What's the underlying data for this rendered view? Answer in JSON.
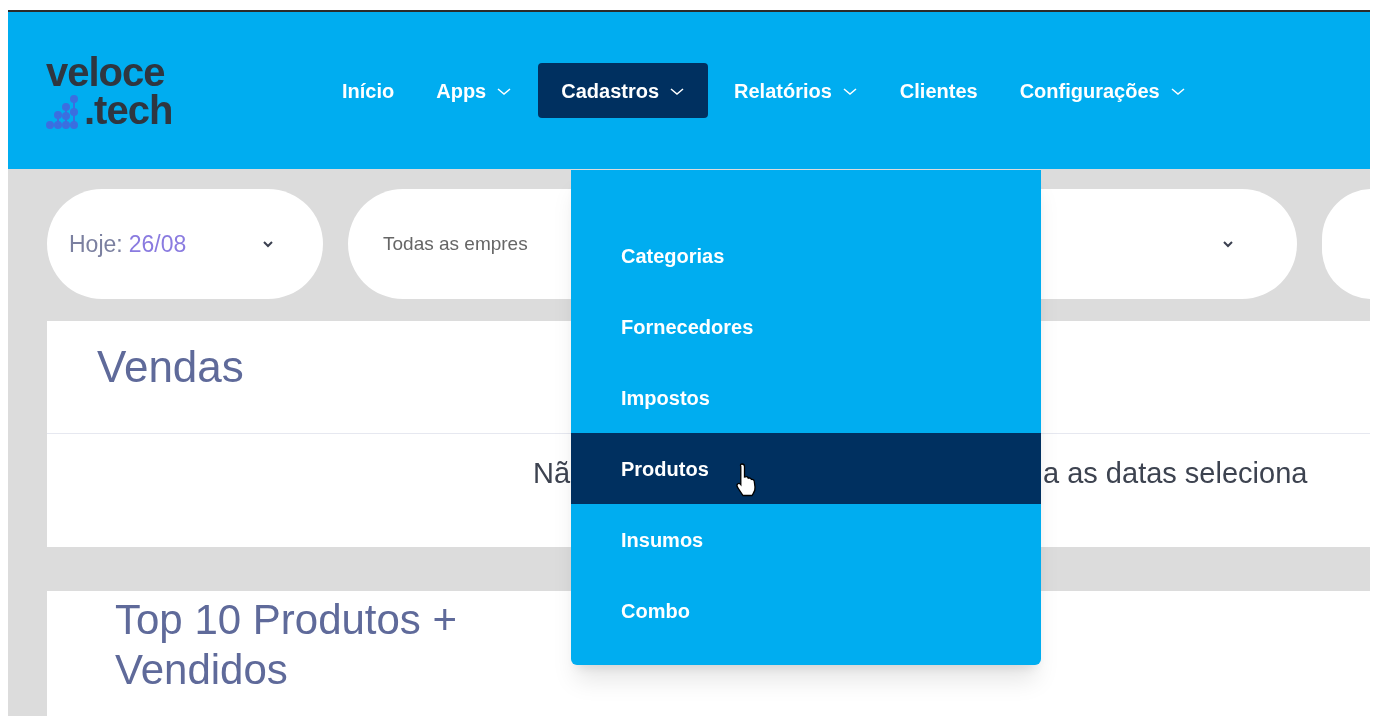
{
  "logo": {
    "line1": "veloce",
    "line2": ".tech"
  },
  "nav": [
    {
      "label": "Início",
      "has_menu": false,
      "selected": false
    },
    {
      "label": "Apps",
      "has_menu": true,
      "selected": false
    },
    {
      "label": "Cadastros",
      "has_menu": true,
      "selected": true
    },
    {
      "label": "Relatórios",
      "has_menu": true,
      "selected": false
    },
    {
      "label": "Clientes",
      "has_menu": false,
      "selected": false
    },
    {
      "label": "Configurações",
      "has_menu": true,
      "selected": false
    }
  ],
  "filters": {
    "date_label": "Hoje:",
    "date_value": "26/08",
    "company": "Todas as empres"
  },
  "sales_card": {
    "title": "Vendas",
    "message_start": "Nã",
    "message_end": "a as datas seleciona"
  },
  "top_card": {
    "title": "Top 10 Produtos + Vendidos"
  },
  "dropdown": [
    {
      "label": "Categorias",
      "selected": false
    },
    {
      "label": "Fornecedores",
      "selected": false
    },
    {
      "label": "Impostos",
      "selected": false
    },
    {
      "label": "Produtos",
      "selected": true
    },
    {
      "label": "Insumos",
      "selected": false
    },
    {
      "label": "Combo",
      "selected": false
    }
  ]
}
